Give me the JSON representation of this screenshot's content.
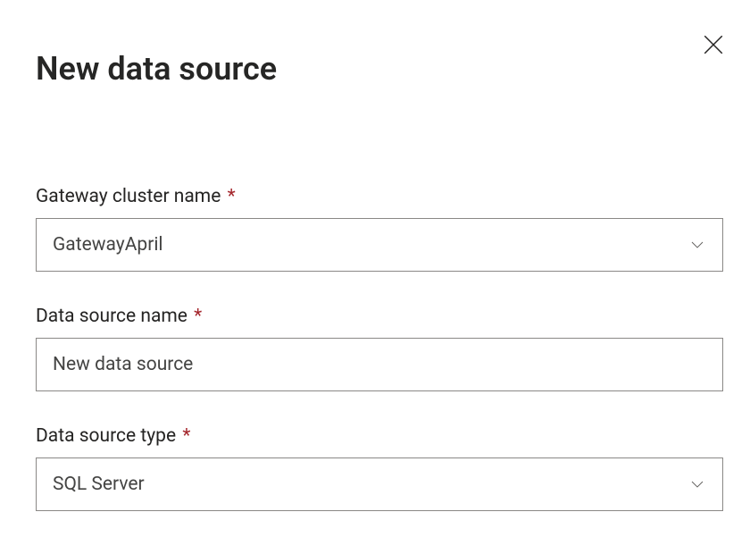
{
  "header": {
    "title": "New data source"
  },
  "form": {
    "gateway": {
      "label": "Gateway cluster name",
      "required_mark": "*",
      "value": "GatewayApril"
    },
    "dsname": {
      "label": "Data source name",
      "required_mark": "*",
      "value": "New data source"
    },
    "dstype": {
      "label": "Data source type",
      "required_mark": "*",
      "value": "SQL Server"
    }
  }
}
